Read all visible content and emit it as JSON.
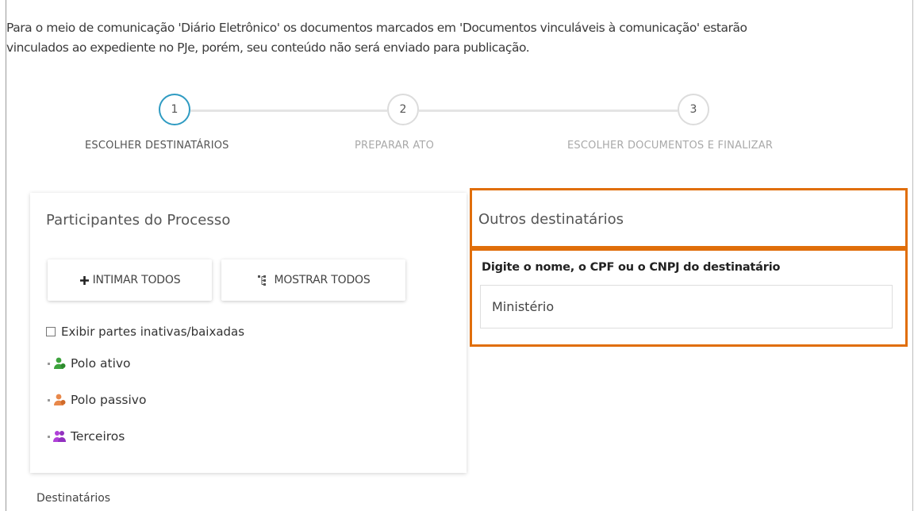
{
  "notice": {
    "line1": "Para o meio de comunicação 'Diário Eletrônico' os documentos marcados em 'Documentos vinculáveis à comunicação' estarão",
    "line2": "vinculados ao expediente no PJe, porém, seu conteúdo não será enviado para publicação."
  },
  "stepper": {
    "steps": [
      {
        "number": "1",
        "label": "ESCOLHER DESTINATÁRIOS",
        "active": true
      },
      {
        "number": "2",
        "label": "PREPARAR ATO",
        "active": false
      },
      {
        "number": "3",
        "label": "ESCOLHER DOCUMENTOS E FINALIZAR",
        "active": false
      }
    ],
    "active_color": "#2f9bc2"
  },
  "participants": {
    "title": "Participantes do Processo",
    "intimar_label": "INTIMAR TODOS",
    "mostrar_label": "MOSTRAR TODOS",
    "show_inactive_label": "Exibir partes inativas/baixadas",
    "show_inactive_checked": false,
    "tree": [
      {
        "label": "Polo ativo",
        "icon": "user-group-icon",
        "color": "#3da33d"
      },
      {
        "label": "Polo passivo",
        "icon": "user-group-icon",
        "color": "#e8884a"
      },
      {
        "label": "Terceiros",
        "icon": "user-group-icon",
        "color": "#b040d8"
      }
    ]
  },
  "outros": {
    "title": "Outros destinatários",
    "search_label": "Digite o nome, o CPF ou o CNPJ do destinatário",
    "search_value": "Ministério",
    "highlight_color": "#e06e0a"
  },
  "destinatarios_label": "Destinatários"
}
